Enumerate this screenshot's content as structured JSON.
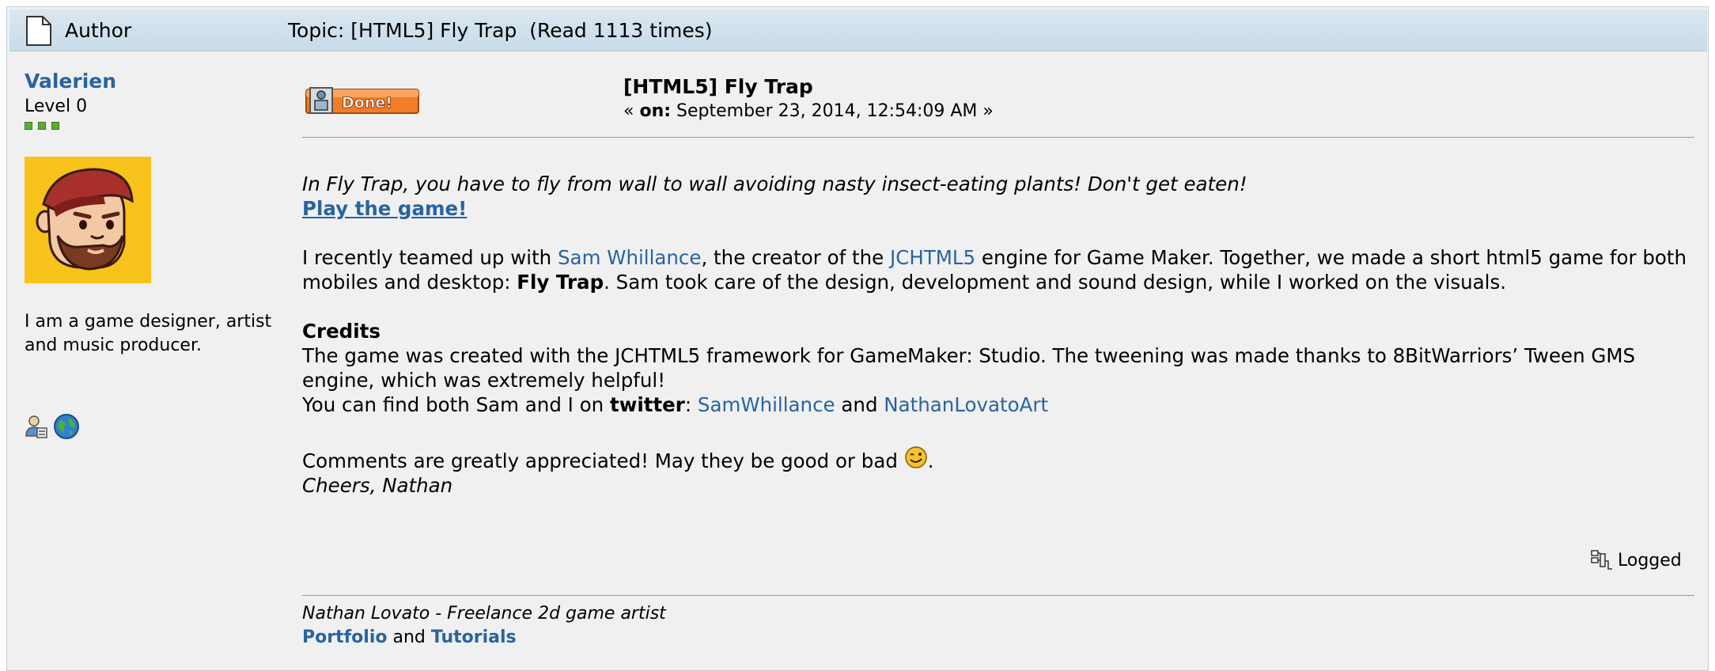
{
  "header": {
    "author_label": "Author",
    "topic_title": "Topic: [HTML5] Fly Trap  (Read 1113 times)"
  },
  "user": {
    "name": "Valerien",
    "level": "Level 0",
    "bio_line1": "I am a game designer, artist",
    "bio_line2": "and music producer."
  },
  "post": {
    "title": "[HTML5] Fly Trap",
    "date_prefix": "« ",
    "date_on": "on:",
    "date_text": " September 23, 2014, 12:54:09 AM »",
    "intro": "In Fly Trap, you have to fly from wall to wall avoiding nasty insect-eating plants! Don't get eaten!",
    "play_link": "Play the game!",
    "para1_a": "I recently teamed up with ",
    "para1_link1": "Sam Whillance",
    "para1_b": ", the creator of the ",
    "para1_link2": "JCHTML5",
    "para1_c": " engine for Game Maker. Together, we made a short html5 game for both",
    "para1_d": "mobiles and desktop: ",
    "para1_bold": "Fly Trap",
    "para1_e": ". Sam took care of the design, development and sound design, while I worked on the visuals.",
    "credits_heading": "Credits",
    "credits_line1": "The game was created with the JCHTML5 framework for GameMaker: Studio. The tweening was made thanks to 8BitWarriors’ Tween GMS",
    "credits_line2": "engine, which was extremely helpful!",
    "credits_line3_a": "You can find both Sam and I on ",
    "credits_twitter": "twitter",
    "credits_colon": ": ",
    "credits_link1": "SamWhillance",
    "credits_and": " and ",
    "credits_link2": "NathanLovatoArt",
    "comments": "Comments are greatly appreciated! May they be good or bad ",
    "comments_end": ".",
    "signoff": "Cheers, Nathan",
    "logged_label": "Logged"
  },
  "signature": {
    "line1": "Nathan Lovato - Freelance 2d game artist",
    "link1": "Portfolio",
    "and": " and ",
    "link2": "Tutorials"
  },
  "colors": {
    "link": "#2864a0",
    "header_bg": "#d0e1ed",
    "avatar_bg": "#f7c31a",
    "badge": "#f07d28"
  }
}
